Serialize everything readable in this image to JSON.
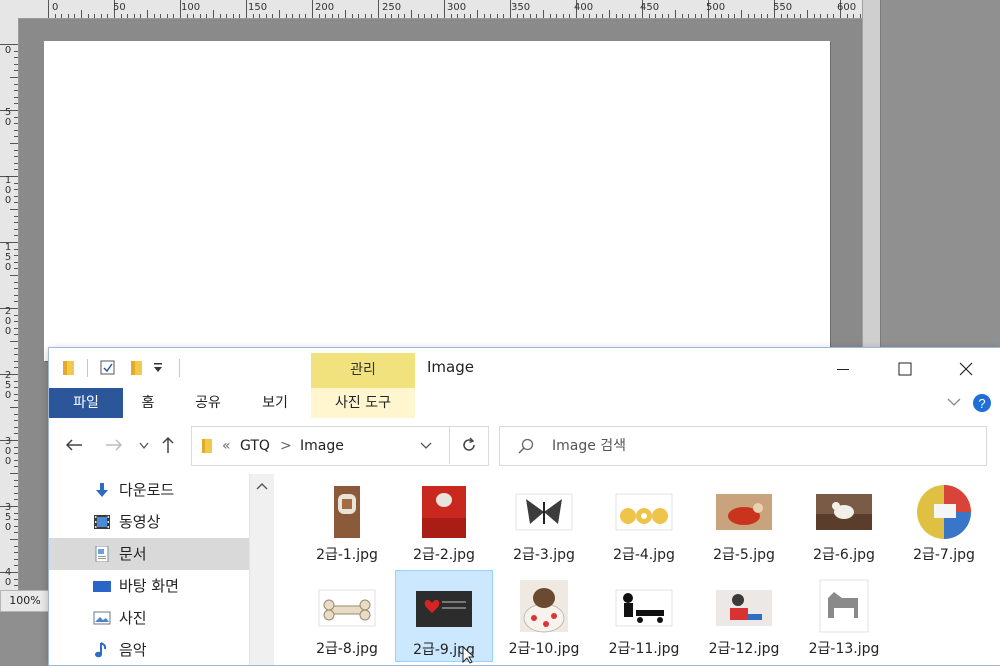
{
  "ruler": {
    "top_ticks": [
      "0",
      "50",
      "100",
      "150",
      "200",
      "250",
      "300",
      "350",
      "400",
      "450",
      "500",
      "550",
      "600"
    ],
    "left_ticks": [
      "0",
      "5 0",
      "1 0 0",
      "1 5 0",
      "2 0 0",
      "2 5 0",
      "3 0 0",
      "3 5 0",
      "4 0"
    ]
  },
  "zoom": "100%",
  "explorer": {
    "window_title": "Image",
    "context_header": "관리",
    "tabs": {
      "file": "파일",
      "home": "홈",
      "share": "공유",
      "view": "보기",
      "phototools": "사진 도구"
    },
    "address": {
      "chevron": "«",
      "crumb1": "GTQ",
      "separator": ">",
      "crumb2": "Image"
    },
    "search_placeholder": "Image 검색",
    "nav_items": [
      {
        "label": "다운로드",
        "icon": "download-icon"
      },
      {
        "label": "동영상",
        "icon": "video-icon"
      },
      {
        "label": "문서",
        "icon": "document-icon"
      },
      {
        "label": "바탕 화면",
        "icon": "desktop-icon"
      },
      {
        "label": "사진",
        "icon": "pictures-icon"
      },
      {
        "label": "음악",
        "icon": "music-icon"
      }
    ],
    "files": [
      {
        "name": "2급-1.jpg"
      },
      {
        "name": "2급-2.jpg"
      },
      {
        "name": "2급-3.jpg"
      },
      {
        "name": "2급-4.jpg"
      },
      {
        "name": "2급-5.jpg"
      },
      {
        "name": "2급-6.jpg"
      },
      {
        "name": "2급-7.jpg"
      },
      {
        "name": "2급-8.jpg"
      },
      {
        "name": "2급-9.jpg"
      },
      {
        "name": "2급-10.jpg"
      },
      {
        "name": "2급-11.jpg"
      },
      {
        "name": "2급-12.jpg"
      },
      {
        "name": "2급-13.jpg"
      }
    ],
    "selected_file": "2급-9.jpg",
    "colors": {
      "file_tab": "#2b579a",
      "context_tab": "#f2e27d",
      "selection": "#cce8ff",
      "help": "#1f6fd6"
    }
  }
}
